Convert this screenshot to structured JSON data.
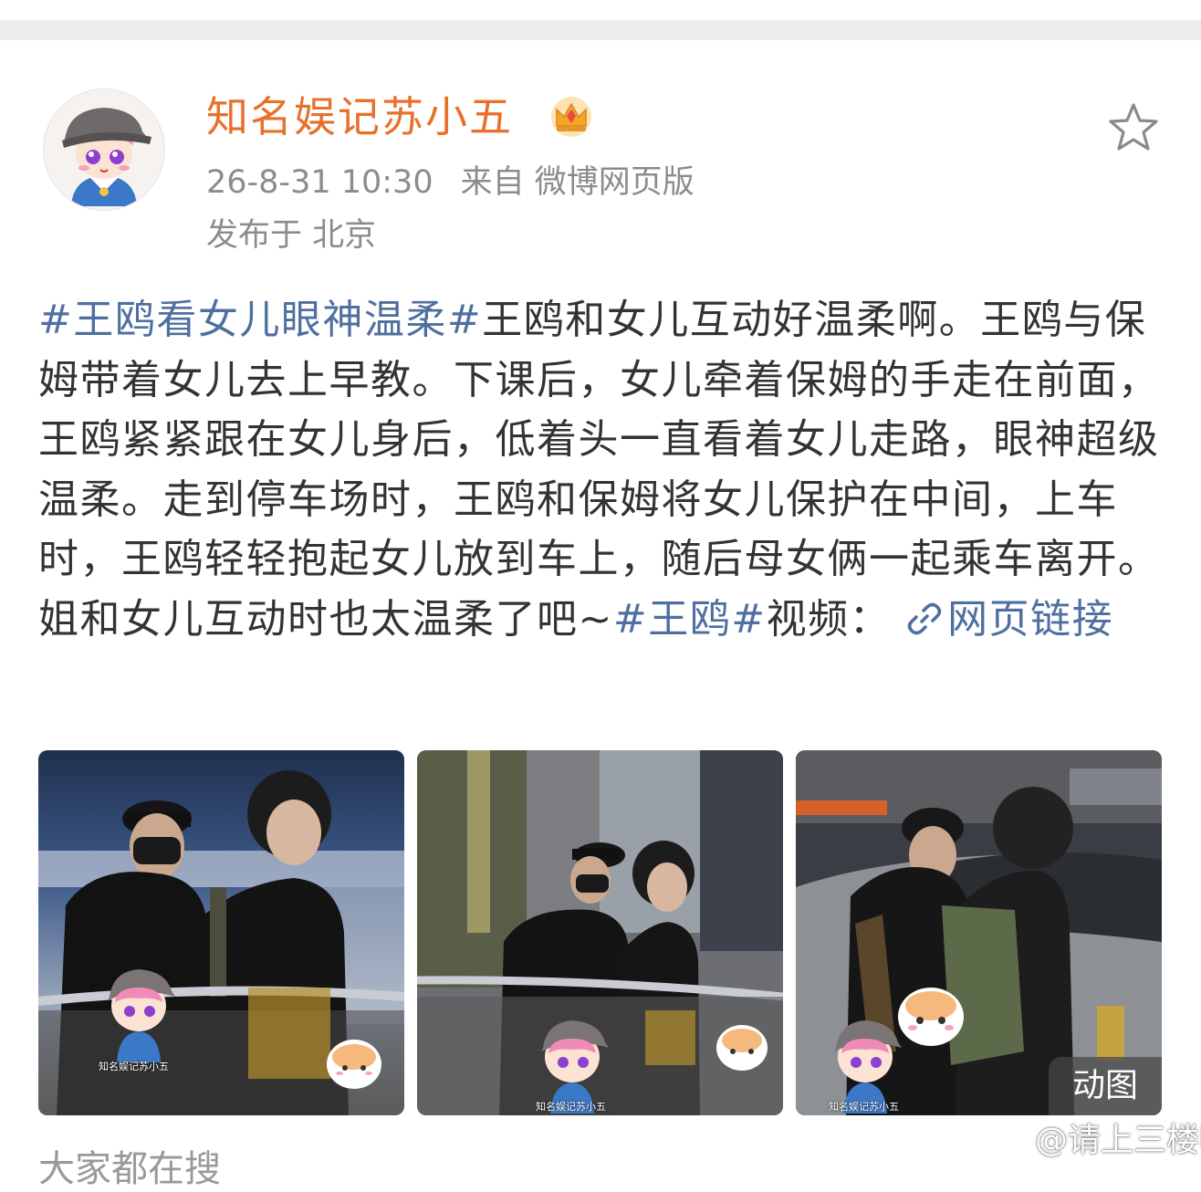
{
  "post": {
    "author": "知名娱记苏小五",
    "timestamp": "26-8-31 10:30",
    "source": "来自 微博网页版",
    "location": "发布于 北京",
    "text": {
      "tag1": "#王鸥看女儿眼神温柔#",
      "body": "王鸥和女儿互动好温柔啊。王鸥与保姆带着女儿去上早教。下课后，女儿牵着保姆的手走在前面，王鸥紧紧跟在女儿身后，低着头一直看着女儿走路，眼神超级温柔。走到停车场时，王鸥和保姆将女儿保护在中间，上车时，王鸥轻轻抱起女儿放到车上，随后母女俩一起乘车离开。姐和女儿互动时也太温柔了吧~",
      "tag2": "#王鸥#",
      "video_label": "视频：",
      "link_label": "网页链接"
    },
    "photos": [
      {
        "icon": "photo-1",
        "sticker_text": "知名娱记苏小五"
      },
      {
        "icon": "photo-2",
        "sticker_text": "知名娱记苏小五"
      },
      {
        "icon": "photo-3",
        "sticker_text": "知名娱记苏小五",
        "badge": "动图"
      }
    ],
    "icons": {
      "favorite": "star-icon",
      "link": "link-icon",
      "verified": "crown-icon"
    }
  },
  "bottom": {
    "partial_text": "大家都在搜"
  },
  "watermark": "@请上三楼吧",
  "colors": {
    "author": "#e8702a",
    "tag": "#4f6fa0",
    "meta": "#8c8c8c",
    "body_text": "#333333"
  }
}
